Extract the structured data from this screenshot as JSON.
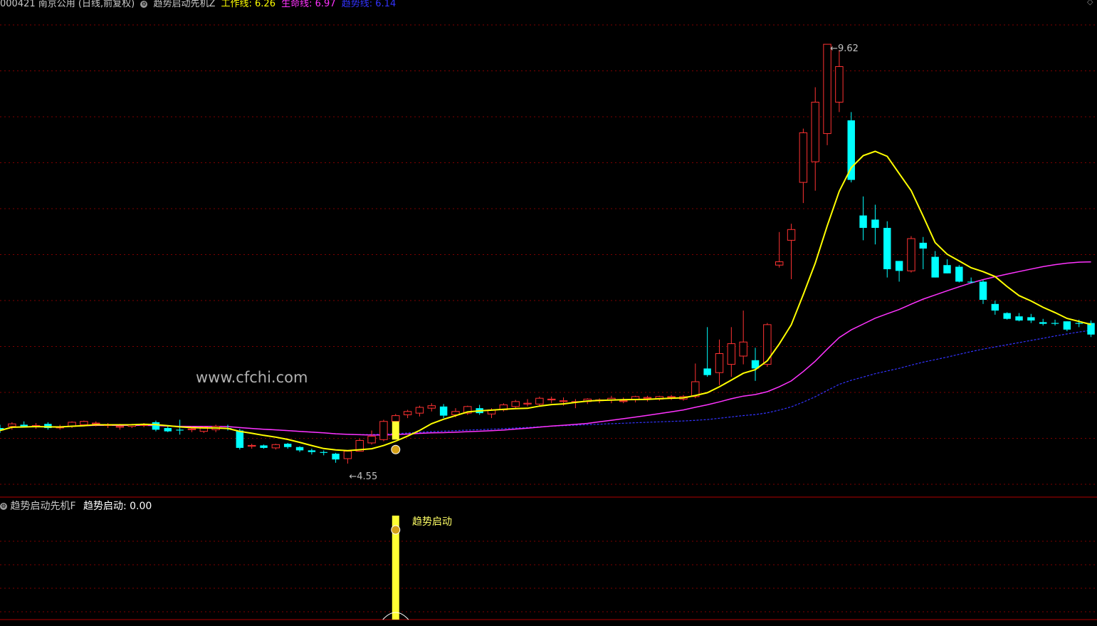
{
  "header": {
    "stock": "000421 南京公用 (日线,前复权)",
    "indicator": "趋势启动先机Z",
    "work_line_label": "工作线:",
    "work_line_value": "6.26",
    "life_line_label": "生命线:",
    "life_line_value": "6.97",
    "trend_line_label": "趋势线:",
    "trend_line_value": "6.14"
  },
  "sub_header": {
    "indicator": "趋势启动先机F",
    "signal_label": "趋势启动:",
    "signal_value": "0.00"
  },
  "signal_marker": "趋势启动",
  "watermark": "www.cfchi.com",
  "price_high_label": "9.62",
  "price_low_label": "4.55",
  "colors": {
    "up": "#ff3232",
    "down": "#00ffff",
    "work_line": "#ffff00",
    "life_line": "#ff33ff",
    "trend_line": "#3333ff",
    "signal_bar": "#ffff33",
    "grid": "#800000"
  },
  "chart_data": {
    "type": "candlestick",
    "ylim": [
      4.3,
      10.0
    ],
    "candles": [
      {
        "o": 4.98,
        "h": 5.02,
        "l": 4.92,
        "c": 4.95
      },
      {
        "o": 5.0,
        "h": 5.05,
        "l": 4.96,
        "c": 5.03
      },
      {
        "o": 5.02,
        "h": 5.06,
        "l": 4.99,
        "c": 5.0
      },
      {
        "o": 5.0,
        "h": 5.04,
        "l": 4.97,
        "c": 5.01
      },
      {
        "o": 5.03,
        "h": 5.05,
        "l": 4.96,
        "c": 4.98
      },
      {
        "o": 4.99,
        "h": 5.02,
        "l": 4.96,
        "c": 4.99
      },
      {
        "o": 5.0,
        "h": 5.06,
        "l": 4.98,
        "c": 5.05
      },
      {
        "o": 5.02,
        "h": 5.07,
        "l": 5.0,
        "c": 5.06
      },
      {
        "o": 5.03,
        "h": 5.06,
        "l": 5.0,
        "c": 5.04
      },
      {
        "o": 5.01,
        "h": 5.04,
        "l": 4.98,
        "c": 5.02
      },
      {
        "o": 4.99,
        "h": 5.03,
        "l": 4.96,
        "c": 5.0
      },
      {
        "o": 5.0,
        "h": 5.03,
        "l": 4.98,
        "c": 5.02
      },
      {
        "o": 5.01,
        "h": 5.04,
        "l": 4.99,
        "c": 5.02
      },
      {
        "o": 5.05,
        "h": 5.07,
        "l": 4.94,
        "c": 4.96
      },
      {
        "o": 4.98,
        "h": 5.01,
        "l": 4.93,
        "c": 4.94
      },
      {
        "o": 4.96,
        "h": 5.08,
        "l": 4.9,
        "c": 4.95
      },
      {
        "o": 4.96,
        "h": 5.0,
        "l": 4.93,
        "c": 4.97
      },
      {
        "o": 4.94,
        "h": 5.0,
        "l": 4.92,
        "c": 4.99
      },
      {
        "o": 4.96,
        "h": 5.02,
        "l": 4.93,
        "c": 5.0
      },
      {
        "o": 4.98,
        "h": 5.02,
        "l": 4.95,
        "c": 4.97
      },
      {
        "o": 4.95,
        "h": 4.97,
        "l": 4.72,
        "c": 4.74
      },
      {
        "o": 4.76,
        "h": 4.79,
        "l": 4.73,
        "c": 4.77
      },
      {
        "o": 4.77,
        "h": 4.78,
        "l": 4.73,
        "c": 4.74
      },
      {
        "o": 4.74,
        "h": 4.79,
        "l": 4.72,
        "c": 4.78
      },
      {
        "o": 4.79,
        "h": 4.8,
        "l": 4.73,
        "c": 4.75
      },
      {
        "o": 4.75,
        "h": 4.76,
        "l": 4.69,
        "c": 4.71
      },
      {
        "o": 4.71,
        "h": 4.73,
        "l": 4.66,
        "c": 4.69
      },
      {
        "o": 4.69,
        "h": 4.71,
        "l": 4.65,
        "c": 4.68
      },
      {
        "o": 4.67,
        "h": 4.68,
        "l": 4.56,
        "c": 4.6
      },
      {
        "o": 4.61,
        "h": 4.71,
        "l": 4.55,
        "c": 4.7
      },
      {
        "o": 4.7,
        "h": 4.85,
        "l": 4.7,
        "c": 4.83
      },
      {
        "o": 4.8,
        "h": 4.95,
        "l": 4.78,
        "c": 4.88
      },
      {
        "o": 4.84,
        "h": 5.08,
        "l": 4.82,
        "c": 5.06
      },
      {
        "o": 5.06,
        "h": 5.15,
        "l": 5.02,
        "c": 5.13
      },
      {
        "o": 5.14,
        "h": 5.2,
        "l": 5.1,
        "c": 5.18
      },
      {
        "o": 5.16,
        "h": 5.25,
        "l": 5.12,
        "c": 5.23
      },
      {
        "o": 5.22,
        "h": 5.28,
        "l": 5.18,
        "c": 5.25
      },
      {
        "o": 5.24,
        "h": 5.27,
        "l": 5.1,
        "c": 5.13
      },
      {
        "o": 5.14,
        "h": 5.22,
        "l": 5.11,
        "c": 5.18
      },
      {
        "o": 5.16,
        "h": 5.25,
        "l": 5.14,
        "c": 5.24
      },
      {
        "o": 5.22,
        "h": 5.26,
        "l": 5.14,
        "c": 5.16
      },
      {
        "o": 5.15,
        "h": 5.22,
        "l": 5.1,
        "c": 5.2
      },
      {
        "o": 5.2,
        "h": 5.28,
        "l": 5.18,
        "c": 5.26
      },
      {
        "o": 5.24,
        "h": 5.32,
        "l": 5.22,
        "c": 5.3
      },
      {
        "o": 5.27,
        "h": 5.33,
        "l": 5.24,
        "c": 5.28
      },
      {
        "o": 5.27,
        "h": 5.36,
        "l": 5.25,
        "c": 5.34
      },
      {
        "o": 5.32,
        "h": 5.36,
        "l": 5.28,
        "c": 5.33
      },
      {
        "o": 5.3,
        "h": 5.35,
        "l": 5.25,
        "c": 5.31
      },
      {
        "o": 5.29,
        "h": 5.33,
        "l": 5.22,
        "c": 5.3
      },
      {
        "o": 5.3,
        "h": 5.34,
        "l": 5.27,
        "c": 5.33
      },
      {
        "o": 5.31,
        "h": 5.34,
        "l": 5.28,
        "c": 5.32
      },
      {
        "o": 5.32,
        "h": 5.37,
        "l": 5.28,
        "c": 5.34
      },
      {
        "o": 5.3,
        "h": 5.35,
        "l": 5.28,
        "c": 5.31
      },
      {
        "o": 5.32,
        "h": 5.37,
        "l": 5.29,
        "c": 5.36
      },
      {
        "o": 5.34,
        "h": 5.37,
        "l": 5.3,
        "c": 5.35
      },
      {
        "o": 5.33,
        "h": 5.37,
        "l": 5.31,
        "c": 5.36
      },
      {
        "o": 5.35,
        "h": 5.38,
        "l": 5.32,
        "c": 5.36
      },
      {
        "o": 5.33,
        "h": 5.38,
        "l": 5.31,
        "c": 5.36
      },
      {
        "o": 5.36,
        "h": 5.76,
        "l": 5.34,
        "c": 5.54
      },
      {
        "o": 5.7,
        "h": 6.2,
        "l": 5.6,
        "c": 5.62
      },
      {
        "o": 5.65,
        "h": 6.05,
        "l": 5.5,
        "c": 5.88
      },
      {
        "o": 5.75,
        "h": 6.2,
        "l": 5.6,
        "c": 6.0
      },
      {
        "o": 5.85,
        "h": 6.4,
        "l": 5.75,
        "c": 6.02
      },
      {
        "o": 5.8,
        "h": 5.95,
        "l": 5.55,
        "c": 5.7
      },
      {
        "o": 5.75,
        "h": 6.25,
        "l": 5.72,
        "c": 6.23
      },
      {
        "o": 6.95,
        "h": 7.35,
        "l": 6.92,
        "c": 6.99
      },
      {
        "o": 7.25,
        "h": 7.45,
        "l": 6.78,
        "c": 7.38
      },
      {
        "o": 7.95,
        "h": 8.6,
        "l": 7.7,
        "c": 8.55
      },
      {
        "o": 8.2,
        "h": 9.1,
        "l": 7.85,
        "c": 8.92
      },
      {
        "o": 8.54,
        "h": 9.62,
        "l": 8.4,
        "c": 9.62
      },
      {
        "o": 8.92,
        "h": 9.55,
        "l": 8.8,
        "c": 9.35
      },
      {
        "o": 8.7,
        "h": 8.8,
        "l": 7.95,
        "c": 7.98
      },
      {
        "o": 7.55,
        "h": 7.78,
        "l": 7.25,
        "c": 7.4
      },
      {
        "o": 7.5,
        "h": 7.68,
        "l": 7.2,
        "c": 7.4
      },
      {
        "o": 7.4,
        "h": 7.48,
        "l": 6.8,
        "c": 6.9
      },
      {
        "o": 7.0,
        "h": 7.0,
        "l": 6.75,
        "c": 6.88
      },
      {
        "o": 6.88,
        "h": 7.3,
        "l": 6.86,
        "c": 7.27
      },
      {
        "o": 7.22,
        "h": 7.29,
        "l": 6.9,
        "c": 7.15
      },
      {
        "o": 7.05,
        "h": 7.12,
        "l": 6.8,
        "c": 6.8
      },
      {
        "o": 6.95,
        "h": 7.02,
        "l": 6.85,
        "c": 6.85
      },
      {
        "o": 6.93,
        "h": 6.95,
        "l": 6.74,
        "c": 6.75
      },
      {
        "o": 6.75,
        "h": 6.8,
        "l": 6.73,
        "c": 6.74
      },
      {
        "o": 6.75,
        "h": 6.77,
        "l": 6.48,
        "c": 6.53
      },
      {
        "o": 6.48,
        "h": 6.52,
        "l": 6.35,
        "c": 6.4
      },
      {
        "o": 6.37,
        "h": 6.38,
        "l": 6.29,
        "c": 6.3
      },
      {
        "o": 6.33,
        "h": 6.37,
        "l": 6.27,
        "c": 6.28
      },
      {
        "o": 6.32,
        "h": 6.36,
        "l": 6.25,
        "c": 6.28
      },
      {
        "o": 6.26,
        "h": 6.3,
        "l": 6.22,
        "c": 6.24
      },
      {
        "o": 6.25,
        "h": 6.29,
        "l": 6.22,
        "c": 6.24
      },
      {
        "o": 6.27,
        "h": 6.27,
        "l": 6.15,
        "c": 6.17
      },
      {
        "o": 6.25,
        "h": 6.29,
        "l": 6.2,
        "c": 6.24
      },
      {
        "o": 6.25,
        "h": 6.28,
        "l": 6.08,
        "c": 6.11
      }
    ],
    "signal_index": 33
  }
}
